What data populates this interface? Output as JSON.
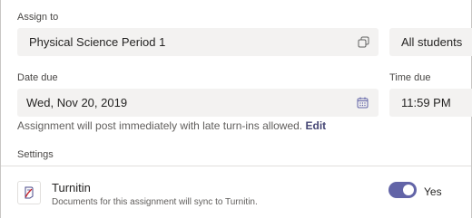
{
  "assign_to": {
    "label": "Assign to",
    "class_value": "Physical Science Period 1",
    "class_icon": "copy-icon",
    "students_value": "All students"
  },
  "date_due": {
    "label": "Date due",
    "value": "Wed, Nov 20, 2019",
    "icon": "calendar-icon"
  },
  "time_due": {
    "label": "Time due",
    "value": "11:59 PM"
  },
  "note": {
    "text": "Assignment will post immediately with late turn-ins allowed.",
    "link": "Edit"
  },
  "settings": {
    "label": "Settings",
    "turnitin": {
      "icon": "turnitin-icon",
      "title": "Turnitin",
      "description": "Documents for this assignment will sync to Turnitin.",
      "toggle_on": true,
      "toggle_label": "Yes"
    }
  },
  "colors": {
    "accent": "#6264a7",
    "field_bg": "#f3f2f1",
    "link": "#464775"
  }
}
